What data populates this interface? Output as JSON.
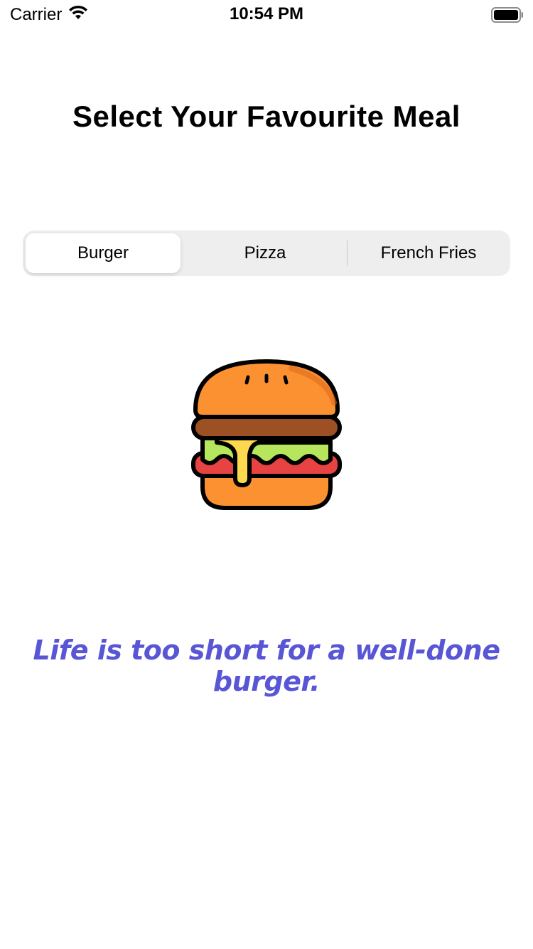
{
  "status_bar": {
    "carrier": "Carrier",
    "time": "10:54 PM"
  },
  "title": "Select Your Favourite Meal",
  "segments": [
    {
      "label": "Burger",
      "selected": true
    },
    {
      "label": "Pizza",
      "selected": false
    },
    {
      "label": "French Fries",
      "selected": false
    }
  ],
  "image": {
    "icon": "burger-icon"
  },
  "quote": "Life is too short for a well-done burger.",
  "colors": {
    "quote": "#5956d6",
    "bun": "#fc9132",
    "patty": "#9d5024",
    "lettuce": "#b5e65c",
    "tomato": "#e84343",
    "cheese": "#fcd94f"
  }
}
